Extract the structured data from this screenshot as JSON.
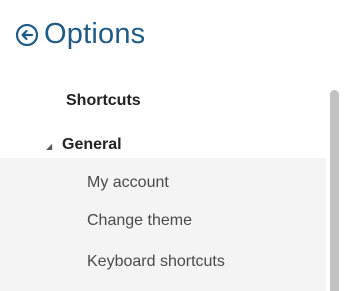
{
  "header": {
    "title": "Options",
    "back_icon": "circle-arrow-left-icon",
    "accent_color": "#1f5b87"
  },
  "nav": {
    "section_header": "Shortcuts",
    "group": {
      "label": "General",
      "expanded": true,
      "items": [
        {
          "label": "My account"
        },
        {
          "label": "Change theme"
        },
        {
          "label": "Keyboard shortcuts"
        }
      ]
    }
  }
}
